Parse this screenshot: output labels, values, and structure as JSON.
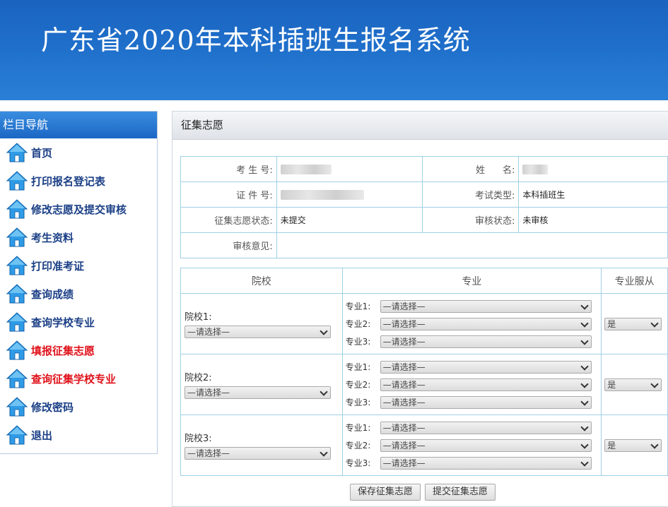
{
  "header": {
    "title": "广东省2020年本科插班生报名系统"
  },
  "sidebar": {
    "title": "栏目导航",
    "items": [
      {
        "label": "首页",
        "highlight": false
      },
      {
        "label": "打印报名登记表",
        "highlight": false
      },
      {
        "label": "修改志愿及提交审核",
        "highlight": false
      },
      {
        "label": "考生资料",
        "highlight": false
      },
      {
        "label": "打印准考证",
        "highlight": false
      },
      {
        "label": "查询成绩",
        "highlight": false
      },
      {
        "label": "查询学校专业",
        "highlight": false
      },
      {
        "label": "填报征集志愿",
        "highlight": true
      },
      {
        "label": "查询征集学校专业",
        "highlight": true
      },
      {
        "label": "修改密码",
        "highlight": false
      },
      {
        "label": "退出",
        "highlight": false
      }
    ]
  },
  "panel": {
    "title": "征集志愿",
    "info": {
      "exam_no_label": "考 生 号:",
      "name_label": "姓      名:",
      "id_label": "证 件 号:",
      "exam_type_label": "考试类型:",
      "exam_type_value": "本科插班生",
      "status_label": "征集志愿状态:",
      "status_value": "未提交",
      "review_label": "审核状态:",
      "review_value": "未审核",
      "opinion_label": "审核意见:"
    },
    "volunteer": {
      "col_school": "院校",
      "col_major": "专业",
      "col_follow": "专业服从",
      "placeholder": "—请选择—",
      "rows": [
        {
          "school_label": "院校1:",
          "majors": [
            "专业1:",
            "专业2:",
            "专业3:"
          ],
          "follow": "是"
        },
        {
          "school_label": "院校2:",
          "majors": [
            "专业1:",
            "专业2:",
            "专业3:"
          ],
          "follow": "是"
        },
        {
          "school_label": "院校3:",
          "majors": [
            "专业1:",
            "专业2:",
            "专业3:"
          ],
          "follow": "是"
        }
      ]
    },
    "buttons": {
      "save": "保存征集志愿",
      "submit": "提交征集志愿"
    }
  },
  "colors": {
    "header_blue": "#1f6fca",
    "nav_blue": "#1b3f86",
    "nav_red": "#e0131c",
    "table_border": "#9fd0e6"
  }
}
